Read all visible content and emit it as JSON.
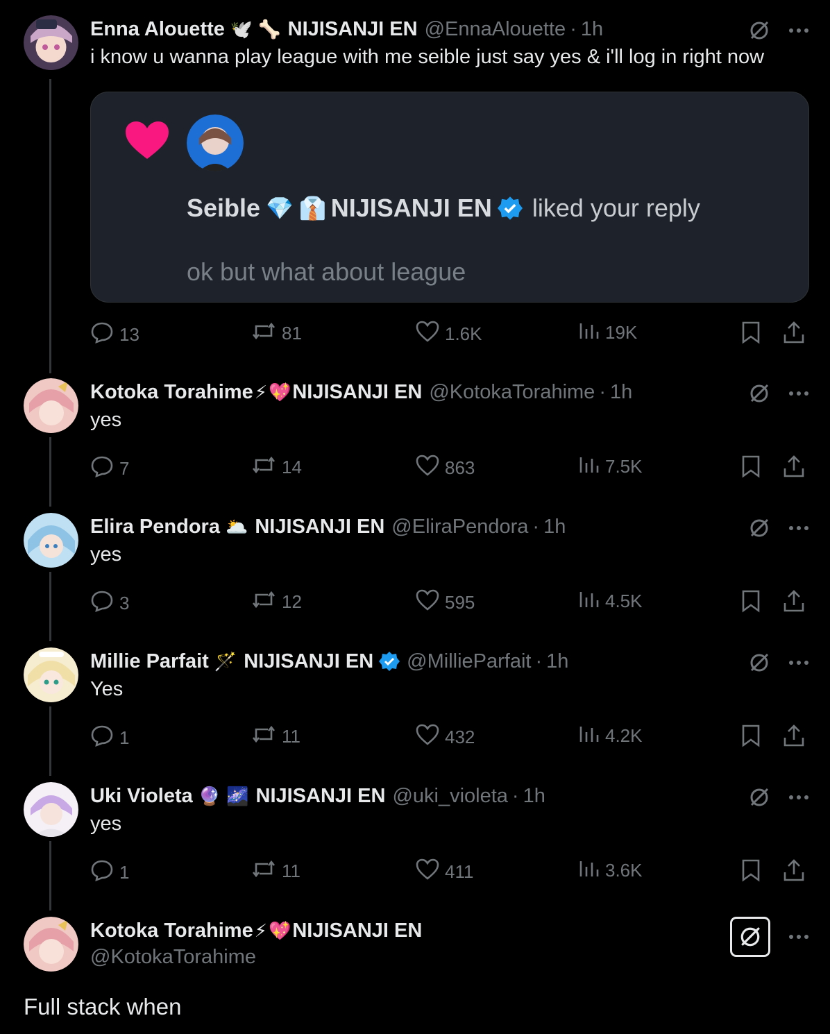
{
  "posts": [
    {
      "name": "Enna Alouette",
      "emojis": [
        "🕊️",
        "🦴"
      ],
      "tag": "NIJISANJI EN",
      "verified": false,
      "handle": "@EnnaAlouette",
      "time": "1h",
      "text": "i know u wanna play league with me seible just say yes & i'll log in right now",
      "stats": {
        "replies": "13",
        "reposts": "81",
        "likes": "1.6K",
        "views": "19K"
      },
      "avatar_color": "#caa7c9"
    },
    {
      "name": "Kotoka Torahime",
      "emojis": [
        "⚡",
        "💖"
      ],
      "tag": "NIJISANJI EN",
      "verified": false,
      "handle": "@KotokaTorahime",
      "time": "1h",
      "text": "yes",
      "stats": {
        "replies": "7",
        "reposts": "14",
        "likes": "863",
        "views": "7.5K"
      },
      "avatar_color": "#e6a0a8"
    },
    {
      "name": "Elira Pendora",
      "emojis": [
        "🌥️"
      ],
      "tag": "NIJISANJI EN",
      "verified": false,
      "handle": "@EliraPendora",
      "time": "1h",
      "text": "yes",
      "stats": {
        "replies": "3",
        "reposts": "12",
        "likes": "595",
        "views": "4.5K"
      },
      "avatar_color": "#8ec3e6"
    },
    {
      "name": "Millie Parfait",
      "emojis": [
        "🪄"
      ],
      "tag": "NIJISANJI EN",
      "verified": true,
      "handle": "@MillieParfait",
      "time": "1h",
      "text": "Yes",
      "stats": {
        "replies": "1",
        "reposts": "11",
        "likes": "432",
        "views": "4.2K"
      },
      "avatar_color": "#f1dfa8"
    },
    {
      "name": "Uki Violeta",
      "emojis": [
        "🔮",
        "🌌"
      ],
      "tag": "NIJISANJI EN",
      "verified": false,
      "handle": "@uki_violeta",
      "time": "1h",
      "text": "yes",
      "stats": {
        "replies": "1",
        "reposts": "11",
        "likes": "411",
        "views": "3.6K"
      },
      "avatar_color": "#d9c9ec"
    }
  ],
  "quote": {
    "name": "Seible",
    "emojis": [
      "💎",
      "👔"
    ],
    "tag": "NIJISANJI EN",
    "liked_text": "liked your reply",
    "reply_text": "ok but what about league"
  },
  "main_post": {
    "name": "Kotoka Torahime",
    "emojis": [
      "⚡",
      "💖"
    ],
    "tag": "NIJISANJI EN",
    "handle": "@KotokaTorahime",
    "text": "Full stack when"
  },
  "colors": {
    "background": "#000000",
    "text": "#e7e9ea",
    "muted": "#71767b",
    "verified": "#1d9bf0",
    "like_heart": "#f91880"
  },
  "icons": [
    "reply-icon",
    "repost-icon",
    "like-icon",
    "views-icon",
    "bookmark-icon",
    "share-icon",
    "grok-icon",
    "more-icon",
    "verified-icon"
  ]
}
